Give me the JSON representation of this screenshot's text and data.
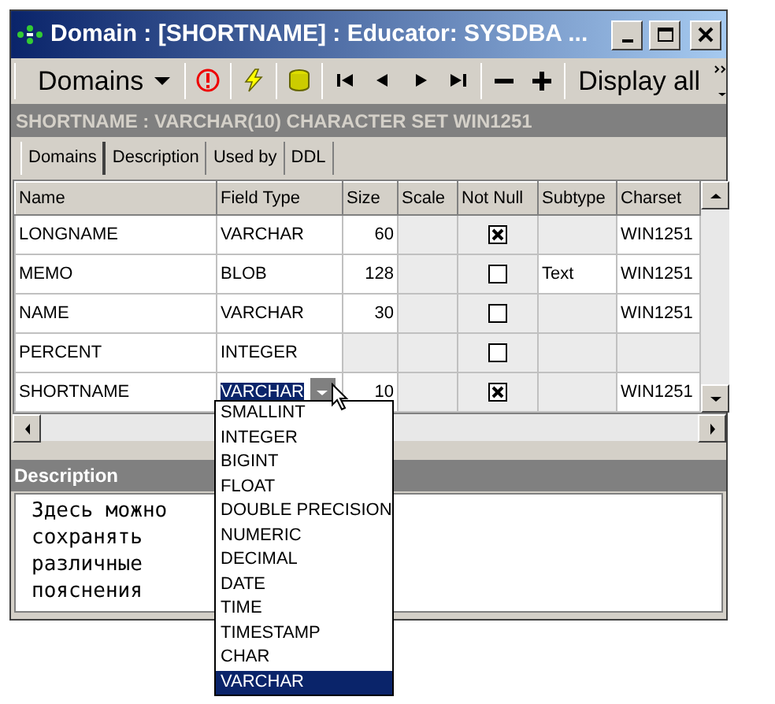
{
  "window": {
    "title": "Domain : [SHORTNAME] : Educator: SYSDBA ..."
  },
  "toolbar": {
    "menu_label": "Domains",
    "display_all": "Display all"
  },
  "info_bar": "SHORTNAME : VARCHAR(10) CHARACTER SET WIN1251",
  "tabs": [
    {
      "label": "Domains",
      "selected": true
    },
    {
      "label": "Description",
      "selected": false
    },
    {
      "label": "Used by",
      "selected": false
    },
    {
      "label": "DDL",
      "selected": false
    }
  ],
  "grid": {
    "columns": [
      "Name",
      "Field Type",
      "Size",
      "Scale",
      "Not Null",
      "Subtype",
      "Charset"
    ],
    "rows": [
      {
        "name": "LONGNAME",
        "field_type": "VARCHAR",
        "size": "60",
        "not_null": true,
        "subtype": "",
        "charset": "WIN1251",
        "selected": false
      },
      {
        "name": "MEMO",
        "field_type": "BLOB",
        "size": "128",
        "not_null": false,
        "subtype": "Text",
        "charset": "WIN1251",
        "selected": false
      },
      {
        "name": "NAME",
        "field_type": "VARCHAR",
        "size": "30",
        "not_null": false,
        "subtype": "",
        "charset": "WIN1251",
        "selected": false
      },
      {
        "name": "PERCENT",
        "field_type": "INTEGER",
        "size": "",
        "not_null": false,
        "subtype": "",
        "charset": "",
        "selected": false
      },
      {
        "name": "SHORTNAME",
        "field_type": "VARCHAR",
        "size": "10",
        "not_null": true,
        "subtype": "",
        "charset": "WIN1251",
        "selected": true
      }
    ]
  },
  "dropdown": {
    "options": [
      {
        "label": "SMALLINT",
        "selected": false
      },
      {
        "label": "INTEGER",
        "selected": false
      },
      {
        "label": "BIGINT",
        "selected": false
      },
      {
        "label": "FLOAT",
        "selected": false
      },
      {
        "label": "DOUBLE PRECISION",
        "selected": false
      },
      {
        "label": "NUMERIC",
        "selected": false
      },
      {
        "label": "DECIMAL",
        "selected": false
      },
      {
        "label": "DATE",
        "selected": false
      },
      {
        "label": "TIME",
        "selected": false
      },
      {
        "label": "TIMESTAMP",
        "selected": false
      },
      {
        "label": "CHAR",
        "selected": false
      },
      {
        "label": "VARCHAR",
        "selected": true
      }
    ]
  },
  "description": {
    "header": "Description",
    "text": "Здесь можно\nсохранять\nразличные\nпояснения"
  }
}
